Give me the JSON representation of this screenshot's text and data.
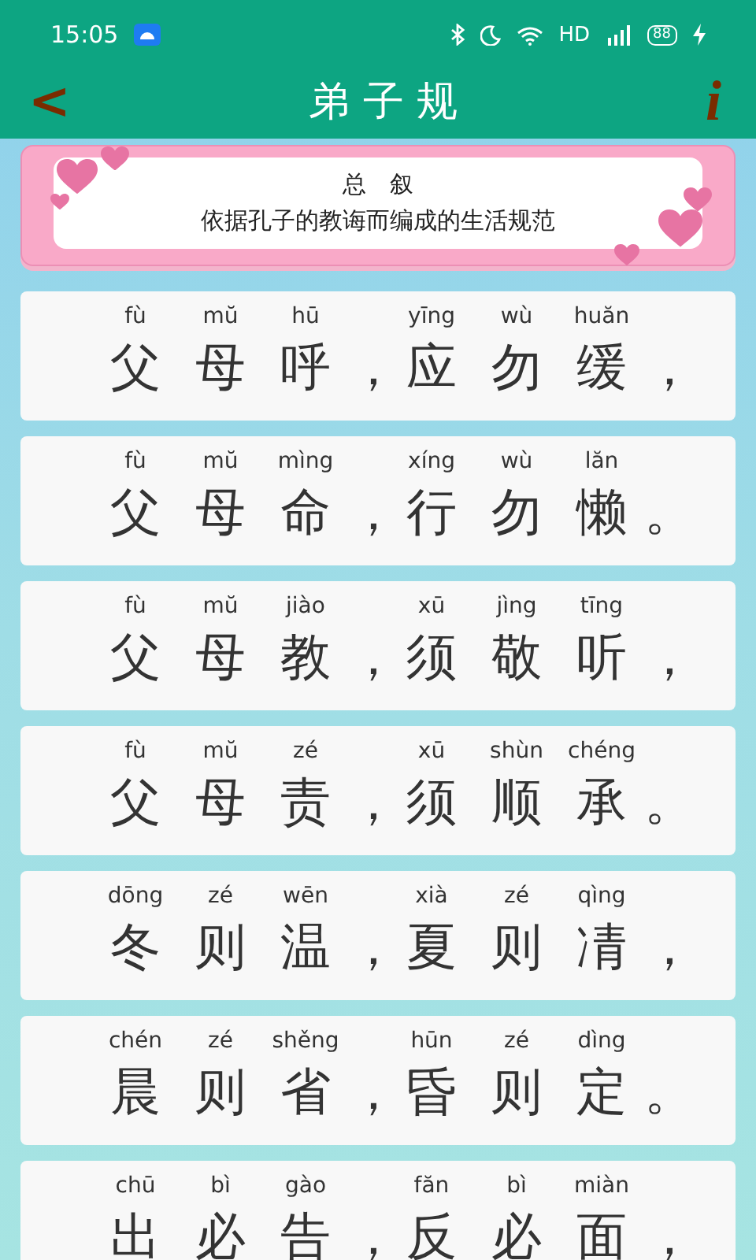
{
  "status_bar": {
    "time": "15:05",
    "network": "HD",
    "battery": "88"
  },
  "header": {
    "back": "<",
    "title": "弟 子 规",
    "info": "i"
  },
  "banner": {
    "heading": "总　叙",
    "subtitle": "依据孔子的教诲而编成的生活规范"
  },
  "verses": [
    {
      "halves": [
        {
          "chars": [
            {
              "hanzi": "父",
              "pinyin": "fù"
            },
            {
              "hanzi": "母",
              "pinyin": "mŭ"
            },
            {
              "hanzi": "呼",
              "pinyin": "hū"
            }
          ],
          "punct": "，"
        },
        {
          "chars": [
            {
              "hanzi": "应",
              "pinyin": "yīng"
            },
            {
              "hanzi": "勿",
              "pinyin": "wù"
            },
            {
              "hanzi": "缓",
              "pinyin": "huăn"
            }
          ],
          "punct": "，"
        }
      ]
    },
    {
      "halves": [
        {
          "chars": [
            {
              "hanzi": "父",
              "pinyin": "fù"
            },
            {
              "hanzi": "母",
              "pinyin": "mŭ"
            },
            {
              "hanzi": "命",
              "pinyin": "mìng"
            }
          ],
          "punct": "，"
        },
        {
          "chars": [
            {
              "hanzi": "行",
              "pinyin": "xíng"
            },
            {
              "hanzi": "勿",
              "pinyin": "wù"
            },
            {
              "hanzi": "懒",
              "pinyin": "lăn"
            }
          ],
          "punct": "。"
        }
      ]
    },
    {
      "halves": [
        {
          "chars": [
            {
              "hanzi": "父",
              "pinyin": "fù"
            },
            {
              "hanzi": "母",
              "pinyin": "mŭ"
            },
            {
              "hanzi": "教",
              "pinyin": "jiào"
            }
          ],
          "punct": "，"
        },
        {
          "chars": [
            {
              "hanzi": "须",
              "pinyin": "xū"
            },
            {
              "hanzi": "敬",
              "pinyin": "jìng"
            },
            {
              "hanzi": "听",
              "pinyin": "tīng"
            }
          ],
          "punct": "，"
        }
      ]
    },
    {
      "halves": [
        {
          "chars": [
            {
              "hanzi": "父",
              "pinyin": "fù"
            },
            {
              "hanzi": "母",
              "pinyin": "mŭ"
            },
            {
              "hanzi": "责",
              "pinyin": "zé"
            }
          ],
          "punct": "，"
        },
        {
          "chars": [
            {
              "hanzi": "须",
              "pinyin": "xū"
            },
            {
              "hanzi": "顺",
              "pinyin": "shùn"
            },
            {
              "hanzi": "承",
              "pinyin": "chéng"
            }
          ],
          "punct": "。"
        }
      ]
    },
    {
      "halves": [
        {
          "chars": [
            {
              "hanzi": "冬",
              "pinyin": "dōng"
            },
            {
              "hanzi": "则",
              "pinyin": "zé"
            },
            {
              "hanzi": "温",
              "pinyin": "wēn"
            }
          ],
          "punct": "，"
        },
        {
          "chars": [
            {
              "hanzi": "夏",
              "pinyin": "xià"
            },
            {
              "hanzi": "则",
              "pinyin": "zé"
            },
            {
              "hanzi": "凊",
              "pinyin": "qìng"
            }
          ],
          "punct": "，"
        }
      ]
    },
    {
      "halves": [
        {
          "chars": [
            {
              "hanzi": "晨",
              "pinyin": "chén"
            },
            {
              "hanzi": "则",
              "pinyin": "zé"
            },
            {
              "hanzi": "省",
              "pinyin": "shěng"
            }
          ],
          "punct": "，"
        },
        {
          "chars": [
            {
              "hanzi": "昏",
              "pinyin": "hūn"
            },
            {
              "hanzi": "则",
              "pinyin": "zé"
            },
            {
              "hanzi": "定",
              "pinyin": "dìng"
            }
          ],
          "punct": "。"
        }
      ]
    },
    {
      "halves": [
        {
          "chars": [
            {
              "hanzi": "出",
              "pinyin": "chū"
            },
            {
              "hanzi": "必",
              "pinyin": "bì"
            },
            {
              "hanzi": "告",
              "pinyin": "gào"
            }
          ],
          "punct": "，"
        },
        {
          "chars": [
            {
              "hanzi": "反",
              "pinyin": "făn"
            },
            {
              "hanzi": "必",
              "pinyin": "bì"
            },
            {
              "hanzi": "面",
              "pinyin": "miàn"
            }
          ],
          "punct": "，"
        }
      ]
    }
  ]
}
